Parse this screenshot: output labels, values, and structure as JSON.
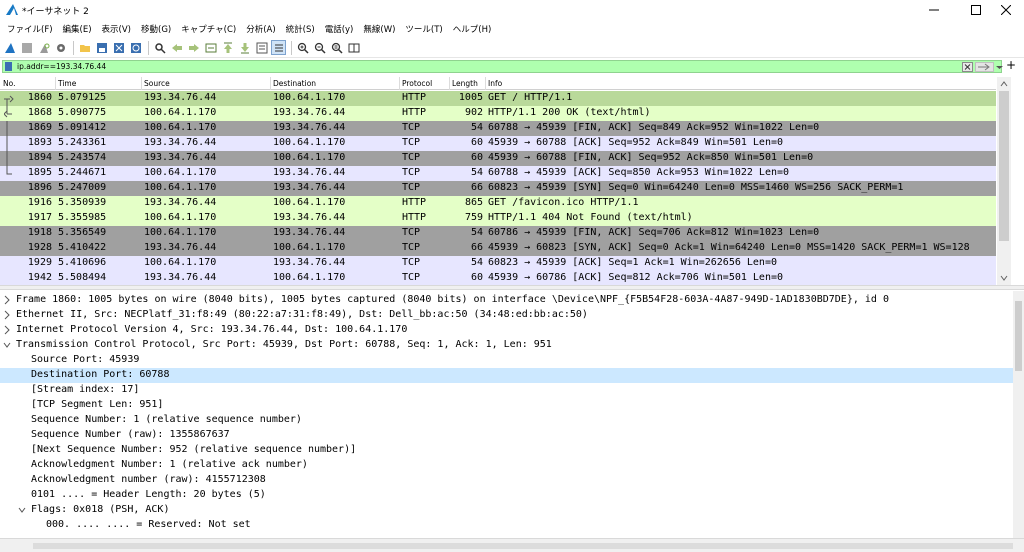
{
  "window": {
    "title": "*イーサネット 2",
    "icon": "wireshark-fin-icon"
  },
  "menu": [
    "ファイル(F)",
    "編集(E)",
    "表示(V)",
    "移動(G)",
    "キャプチャ(C)",
    "分析(A)",
    "統計(S)",
    "電話(y)",
    "無線(W)",
    "ツール(T)",
    "ヘルプ(H)"
  ],
  "filter": {
    "value": "ip.addr==193.34.76.44",
    "bg_color": "#afffaf"
  },
  "columns": {
    "no": "No.",
    "time": "Time",
    "source": "Source",
    "destination": "Destination",
    "protocol": "Protocol",
    "length": "Length",
    "info": "Info"
  },
  "colors": {
    "http": "#e4ffc7",
    "http_selected": "#b9d99a",
    "tcp_plain": "#e7e6ff",
    "tcp_fin": "#a0a0a0",
    "tcp_syn": "#a0a0a0",
    "selection": "#cce8ff"
  },
  "packets": [
    {
      "no": "1860",
      "time": "5.079125",
      "src": "193.34.76.44",
      "dst": "100.64.1.170",
      "proto": "HTTP",
      "len": "1005",
      "info": "GET / HTTP/1.1",
      "bg": "#b9d99a"
    },
    {
      "no": "1868",
      "time": "5.090775",
      "src": "100.64.1.170",
      "dst": "193.34.76.44",
      "proto": "HTTP",
      "len": "902",
      "info": "HTTP/1.1 200 OK  (text/html)",
      "bg": "#e4ffc7"
    },
    {
      "no": "1869",
      "time": "5.091412",
      "src": "100.64.1.170",
      "dst": "193.34.76.44",
      "proto": "TCP",
      "len": "54",
      "info": "60788 → 45939 [FIN, ACK] Seq=849 Ack=952 Win=1022 Len=0",
      "bg": "#a0a0a0"
    },
    {
      "no": "1893",
      "time": "5.243361",
      "src": "193.34.76.44",
      "dst": "100.64.1.170",
      "proto": "TCP",
      "len": "60",
      "info": "45939 → 60788 [ACK] Seq=952 Ack=849 Win=501 Len=0",
      "bg": "#e7e6ff"
    },
    {
      "no": "1894",
      "time": "5.243574",
      "src": "193.34.76.44",
      "dst": "100.64.1.170",
      "proto": "TCP",
      "len": "60",
      "info": "45939 → 60788 [FIN, ACK] Seq=952 Ack=850 Win=501 Len=0",
      "bg": "#a0a0a0"
    },
    {
      "no": "1895",
      "time": "5.244671",
      "src": "100.64.1.170",
      "dst": "193.34.76.44",
      "proto": "TCP",
      "len": "54",
      "info": "60788 → 45939 [ACK] Seq=850 Ack=953 Win=1022 Len=0",
      "bg": "#e7e6ff"
    },
    {
      "no": "1896",
      "time": "5.247009",
      "src": "100.64.1.170",
      "dst": "193.34.76.44",
      "proto": "TCP",
      "len": "66",
      "info": "60823 → 45939 [SYN] Seq=0 Win=64240 Len=0 MSS=1460 WS=256 SACK_PERM=1",
      "bg": "#a0a0a0"
    },
    {
      "no": "1916",
      "time": "5.350939",
      "src": "193.34.76.44",
      "dst": "100.64.1.170",
      "proto": "HTTP",
      "len": "865",
      "info": "GET /favicon.ico HTTP/1.1",
      "bg": "#e4ffc7"
    },
    {
      "no": "1917",
      "time": "5.355985",
      "src": "100.64.1.170",
      "dst": "193.34.76.44",
      "proto": "HTTP",
      "len": "759",
      "info": "HTTP/1.1 404 Not Found  (text/html)",
      "bg": "#e4ffc7"
    },
    {
      "no": "1918",
      "time": "5.356549",
      "src": "100.64.1.170",
      "dst": "193.34.76.44",
      "proto": "TCP",
      "len": "54",
      "info": "60786 → 45939 [FIN, ACK] Seq=706 Ack=812 Win=1023 Len=0",
      "bg": "#a0a0a0"
    },
    {
      "no": "1928",
      "time": "5.410422",
      "src": "193.34.76.44",
      "dst": "100.64.1.170",
      "proto": "TCP",
      "len": "66",
      "info": "45939 → 60823 [SYN, ACK] Seq=0 Ack=1 Win=64240 Len=0 MSS=1420 SACK_PERM=1 WS=128",
      "bg": "#a0a0a0"
    },
    {
      "no": "1929",
      "time": "5.410696",
      "src": "100.64.1.170",
      "dst": "193.34.76.44",
      "proto": "TCP",
      "len": "54",
      "info": "60823 → 45939 [ACK] Seq=1 Ack=1 Win=262656 Len=0",
      "bg": "#e7e6ff"
    },
    {
      "no": "1942",
      "time": "5.508494",
      "src": "193.34.76.44",
      "dst": "100.64.1.170",
      "proto": "TCP",
      "len": "60",
      "info": "45939 → 60786 [ACK] Seq=812 Ack=706 Win=501 Len=0",
      "bg": "#e7e6ff"
    }
  ],
  "details": [
    {
      "exp": "collapsed",
      "indent": 0,
      "text": "Frame 1860: 1005 bytes on wire (8040 bits), 1005 bytes captured (8040 bits) on interface \\Device\\NPF_{F5B54F28-603A-4A87-949D-1AD1830BD7DE}, id 0"
    },
    {
      "exp": "collapsed",
      "indent": 0,
      "text": "Ethernet II, Src: NECPlatf_31:f8:49 (80:22:a7:31:f8:49), Dst: Dell_bb:ac:50 (34:48:ed:bb:ac:50)"
    },
    {
      "exp": "collapsed",
      "indent": 0,
      "text": "Internet Protocol Version 4, Src: 193.34.76.44, Dst: 100.64.1.170"
    },
    {
      "exp": "expanded",
      "indent": 0,
      "text": "Transmission Control Protocol, Src Port: 45939, Dst Port: 60788, Seq: 1, Ack: 1, Len: 951"
    },
    {
      "exp": "none",
      "indent": 1,
      "text": "Source Port: 45939"
    },
    {
      "exp": "none",
      "indent": 1,
      "text": "Destination Port: 60788",
      "selected": true
    },
    {
      "exp": "none",
      "indent": 1,
      "text": "[Stream index: 17]"
    },
    {
      "exp": "none",
      "indent": 1,
      "text": "[TCP Segment Len: 951]"
    },
    {
      "exp": "none",
      "indent": 1,
      "text": "Sequence Number: 1    (relative sequence number)"
    },
    {
      "exp": "none",
      "indent": 1,
      "text": "Sequence Number (raw): 1355867637"
    },
    {
      "exp": "none",
      "indent": 1,
      "text": "[Next Sequence Number: 952    (relative sequence number)]"
    },
    {
      "exp": "none",
      "indent": 1,
      "text": "Acknowledgment Number: 1    (relative ack number)"
    },
    {
      "exp": "none",
      "indent": 1,
      "text": "Acknowledgment number (raw): 4155712308"
    },
    {
      "exp": "none",
      "indent": 1,
      "text": "0101 .... = Header Length: 20 bytes (5)"
    },
    {
      "exp": "expanded",
      "indent": 1,
      "text": "Flags: 0x018 (PSH, ACK)"
    },
    {
      "exp": "none",
      "indent": 2,
      "text": "000. .... .... = Reserved: Not set"
    }
  ]
}
